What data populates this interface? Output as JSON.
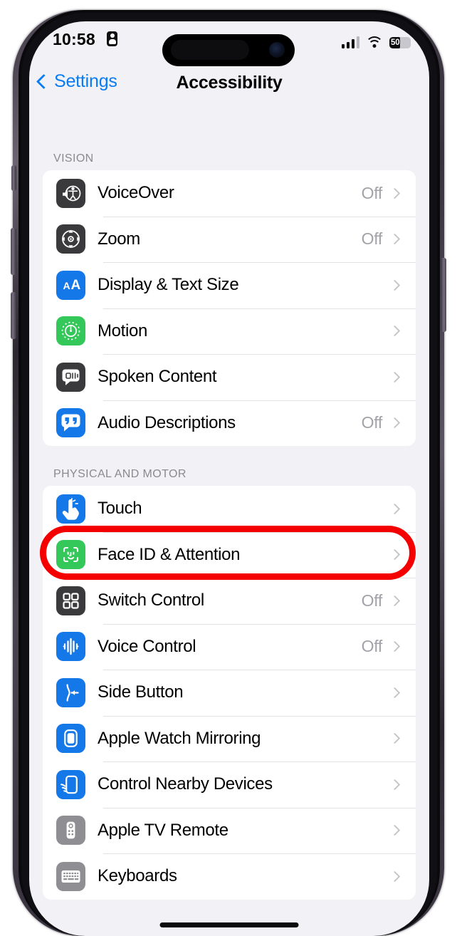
{
  "status_bar": {
    "time": "10:58",
    "recording_icon": "screen-record-icon",
    "cellular_icon": "cellular-signal-icon",
    "wifi_icon": "wifi-icon",
    "battery_percent": "50",
    "battery_level": 50
  },
  "nav": {
    "back_label": "Settings",
    "title": "Accessibility"
  },
  "sections": [
    {
      "header": "VISION",
      "rows": [
        {
          "label": "VoiceOver",
          "value": "Off",
          "icon": "voiceover-icon",
          "icon_color": "#3a3a3c"
        },
        {
          "label": "Zoom",
          "value": "Off",
          "icon": "zoom-icon",
          "icon_color": "#3a3a3c"
        },
        {
          "label": "Display & Text Size",
          "value": "",
          "icon": "display-text-size-icon",
          "icon_color": "#1478e8"
        },
        {
          "label": "Motion",
          "value": "",
          "icon": "motion-icon",
          "icon_color": "#34c759"
        },
        {
          "label": "Spoken Content",
          "value": "",
          "icon": "spoken-content-icon",
          "icon_color": "#3a3a3c"
        },
        {
          "label": "Audio Descriptions",
          "value": "Off",
          "icon": "audio-descriptions-icon",
          "icon_color": "#1478e8"
        }
      ]
    },
    {
      "header": "PHYSICAL AND MOTOR",
      "rows": [
        {
          "label": "Touch",
          "value": "",
          "icon": "touch-icon",
          "icon_color": "#1478e8"
        },
        {
          "label": "Face ID & Attention",
          "value": "",
          "icon": "face-id-icon",
          "icon_color": "#34c759"
        },
        {
          "label": "Switch Control",
          "value": "Off",
          "icon": "switch-control-icon",
          "icon_color": "#3a3a3c"
        },
        {
          "label": "Voice Control",
          "value": "Off",
          "icon": "voice-control-icon",
          "icon_color": "#1478e8"
        },
        {
          "label": "Side Button",
          "value": "",
          "icon": "side-button-icon",
          "icon_color": "#1478e8"
        },
        {
          "label": "Apple Watch Mirroring",
          "value": "",
          "icon": "apple-watch-mirroring-icon",
          "icon_color": "#1478e8"
        },
        {
          "label": "Control Nearby Devices",
          "value": "",
          "icon": "control-nearby-devices-icon",
          "icon_color": "#1478e8"
        },
        {
          "label": "Apple TV Remote",
          "value": "",
          "icon": "apple-tv-remote-icon",
          "icon_color": "#8e8e93"
        },
        {
          "label": "Keyboards",
          "value": "",
          "icon": "keyboards-icon",
          "icon_color": "#8e8e93"
        }
      ]
    }
  ],
  "annotation": {
    "type": "red-rounded-rectangle-highlight",
    "target_row": "Touch",
    "color": "#f40000"
  },
  "colors": {
    "accent_blue": "#0a7cf1",
    "page_background": "#f2f1f6",
    "card_background": "#ffffff",
    "separator": "#e2e1e6",
    "secondary_text": "#a3a2a8",
    "section_header_text": "#8b8a90"
  },
  "home_indicator": "home-indicator"
}
